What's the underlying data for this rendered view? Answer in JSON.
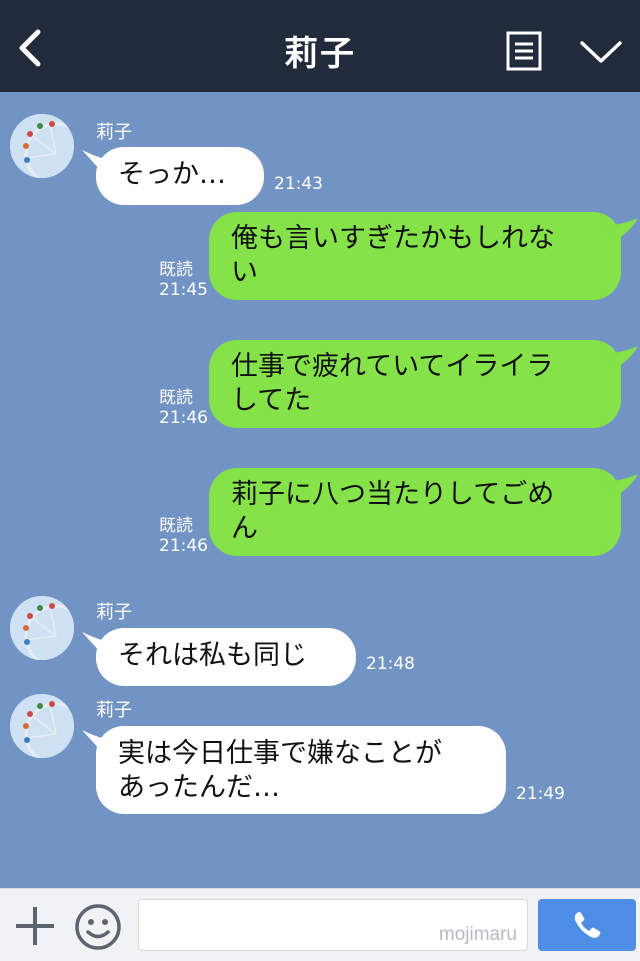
{
  "header": {
    "title": "莉子",
    "back_icon": "chevron-left-icon",
    "menu_icon": "notes-icon",
    "expand_icon": "chevron-down-icon"
  },
  "messages": [
    {
      "sender": "莉子",
      "text": "そっか…",
      "time": "21:43",
      "direction": "in"
    },
    {
      "text": "俺も言いすぎたかもしれない",
      "line1": "俺も言いすぎたかもしれな",
      "line2": "い",
      "read": "既読",
      "time": "21:45",
      "direction": "out"
    },
    {
      "text": "仕事で疲れていてイライラしてた",
      "line1": "仕事で疲れていてイライラ",
      "line2": "してた",
      "read": "既読",
      "time": "21:46",
      "direction": "out"
    },
    {
      "text": "莉子に八つ当たりしてごめん",
      "line1": "莉子に八つ当たりしてごめ",
      "line2": "ん",
      "read": "既読",
      "time": "21:46",
      "direction": "out"
    },
    {
      "sender": "莉子",
      "text": "それは私も同じ",
      "time": "21:48",
      "direction": "in"
    },
    {
      "sender": "莉子",
      "text": "実は今日仕事で嫌なことがあったんだ…",
      "line1": "実は今日仕事で嫌なことが",
      "line2": "あったんだ…",
      "time": "21:49",
      "direction": "in"
    }
  ],
  "footer": {
    "plus_icon": "plus-icon",
    "emoji_icon": "smiley-icon",
    "input_value": "",
    "watermark": "mojimaru",
    "call_icon": "phone-icon"
  },
  "colors": {
    "background": "#7294c4",
    "header": "#222b3b",
    "outgoing_bubble": "#85e249",
    "incoming_bubble": "#ffffff",
    "call_button": "#4f8ee6"
  }
}
